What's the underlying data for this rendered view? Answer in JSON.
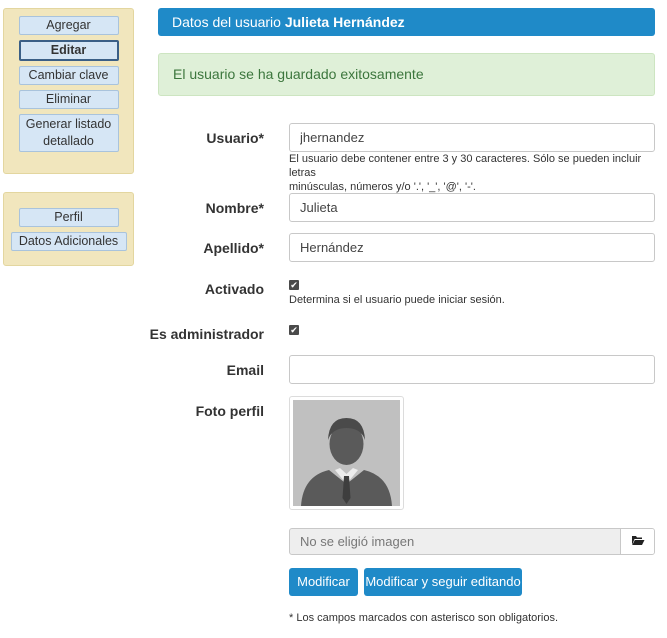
{
  "sidebar": {
    "actions": [
      "Agregar",
      "Editar",
      "Cambiar clave",
      "Eliminar",
      "Generar listado detallado"
    ],
    "user_links": [
      "Perfil",
      "Datos Adicionales"
    ]
  },
  "header": {
    "prefix": "Datos del usuario",
    "user_name": "Julieta Hernández"
  },
  "alert": {
    "message": "El usuario se ha guardado exitosamente"
  },
  "form": {
    "usuario": {
      "label": "Usuario*",
      "value": "jhernandez",
      "help_line1": "El usuario debe contener entre 3 y 30 caracteres. Sólo se pueden incluir letras",
      "help_line2": "minúsculas, números y/o '.', '_', '@', '-'."
    },
    "nombre": {
      "label": "Nombre*",
      "value": "Julieta"
    },
    "apellido": {
      "label": "Apellido*",
      "value": "Hernández"
    },
    "activado": {
      "label": "Activado",
      "checked": true,
      "help": "Determina si el usuario puede iniciar sesión."
    },
    "es_admin": {
      "label": "Es administrador",
      "checked": true
    },
    "email": {
      "label": "Email",
      "value": ""
    },
    "foto": {
      "label": "Foto perfil",
      "file_placeholder": "No se eligió imagen"
    },
    "buttons": {
      "modificar": "Modificar",
      "modificar_seguir": "Modificar y seguir editando"
    },
    "required_note": "* Los campos marcados con asterisco son obligatorios."
  },
  "icons": {
    "browse": "folder-open-icon",
    "checkmark": "checkmark-icon",
    "avatar": "user-silhouette-icon"
  },
  "colors": {
    "primary": "#1f8ac8",
    "success_bg": "#dff0d8",
    "success_text": "#3c763d",
    "sidebar_bg": "#f1e6bd"
  }
}
